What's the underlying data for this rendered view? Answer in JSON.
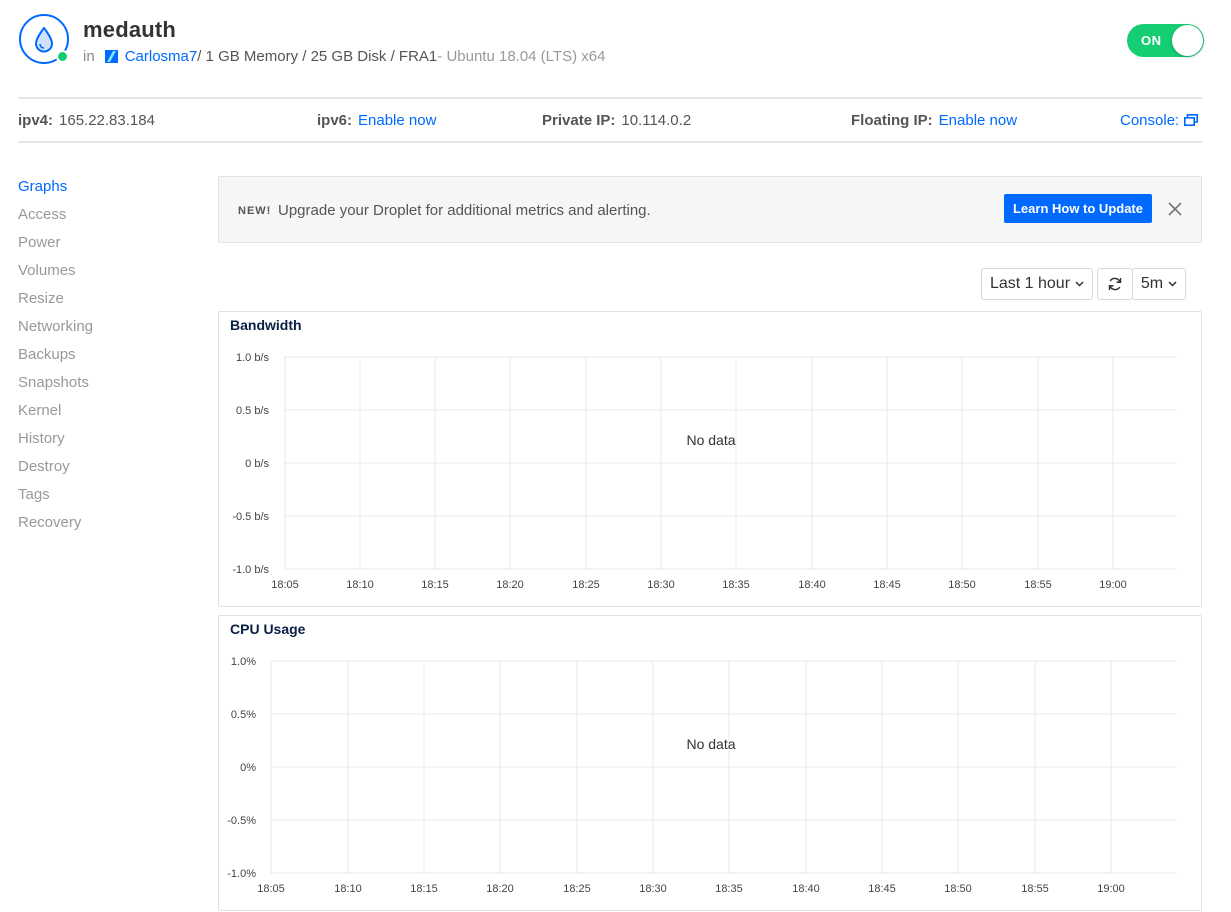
{
  "header": {
    "title": "medauth",
    "in_label": "in",
    "project": "Carlosma7",
    "specs": " / 1 GB Memory / 25 GB Disk / FRA1",
    "os": " - Ubuntu 18.04 (LTS) x64",
    "power_toggle": {
      "label": "ON",
      "state": "on"
    },
    "status_color": "#15cd72"
  },
  "ipbar": {
    "ipv4_label": "ipv4:",
    "ipv4_value": "165.22.83.184",
    "ipv6_label": "ipv6:",
    "ipv6_link": "Enable now",
    "private_label": "Private IP:",
    "private_value": "10.114.0.2",
    "floating_label": "Floating IP:",
    "floating_link": "Enable now",
    "console_label": "Console:"
  },
  "sidebar": {
    "items": [
      {
        "label": "Graphs",
        "active": true
      },
      {
        "label": "Access"
      },
      {
        "label": "Power"
      },
      {
        "label": "Volumes"
      },
      {
        "label": "Resize"
      },
      {
        "label": "Networking"
      },
      {
        "label": "Backups"
      },
      {
        "label": "Snapshots"
      },
      {
        "label": "Kernel"
      },
      {
        "label": "History"
      },
      {
        "label": "Destroy"
      },
      {
        "label": "Tags"
      },
      {
        "label": "Recovery"
      }
    ]
  },
  "banner": {
    "new_tag": "NEW!",
    "message": "Upgrade your Droplet for additional metrics and alerting.",
    "button": "Learn How to Update"
  },
  "controls": {
    "range": "Last 1 hour",
    "interval": "5m"
  },
  "accent_color": "#0069ff",
  "chart_data": [
    {
      "type": "line",
      "title": "Bandwidth",
      "x": [
        "18:05",
        "18:10",
        "18:15",
        "18:20",
        "18:25",
        "18:30",
        "18:35",
        "18:40",
        "18:45",
        "18:50",
        "18:55",
        "19:00"
      ],
      "y_ticks": [
        "1.0 b/s",
        "0.5 b/s",
        "0 b/s",
        "-0.5 b/s",
        "-1.0 b/s"
      ],
      "ylim": [
        -1.0,
        1.0
      ],
      "series": [],
      "empty_message": "No data",
      "grid": true
    },
    {
      "type": "line",
      "title": "CPU Usage",
      "x": [
        "18:05",
        "18:10",
        "18:15",
        "18:20",
        "18:25",
        "18:30",
        "18:35",
        "18:40",
        "18:45",
        "18:50",
        "18:55",
        "19:00"
      ],
      "y_ticks": [
        "1.0%",
        "0.5%",
        "0%",
        "-0.5%",
        "-1.0%"
      ],
      "ylim": [
        -1.0,
        1.0
      ],
      "series": [],
      "empty_message": "No data",
      "grid": true
    }
  ]
}
